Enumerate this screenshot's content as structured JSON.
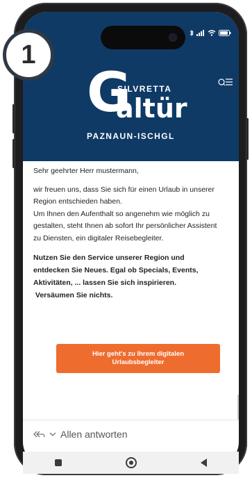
{
  "logo": {
    "top": "SILVRETTA",
    "initial": "G",
    "main": "altür",
    "bottom": "PAZNAUN-ISCHGL"
  },
  "step": {
    "number": "1"
  },
  "email": {
    "greeting": "Sehr geehrter Herr mustermann,",
    "paragraph1": "wir freuen uns, dass Sie sich für einen Urlaub in unserer Region entschieden haben.",
    "paragraph2": "Um Ihnen den Aufenthalt so angenehm wie möglich zu gestalten, steht Ihnen ab sofort Ihr persönlicher Assistent zu Diensten, ein digitaler Reisebegleiter.",
    "bold_paragraph": "Nutzen Sie den Service unserer Region und entdecken Sie Neues. Egal ob Specials, Events, Aktivitäten, ... lassen Sie sich inspirieren.",
    "bold_line2": "Versäumen Sie nichts.",
    "cta_line1": "Hier geht's zu Ihrem digitalen",
    "cta_line2": "Urlaubsbegleiter"
  },
  "reply": {
    "icon": "reply-all-icon",
    "label": "Allen antworten"
  },
  "navbar": {
    "icons": [
      "recent-apps-icon",
      "home-icon",
      "back-icon"
    ]
  },
  "status_icons": [
    "bluetooth-icon",
    "signal-icon",
    "wifi-icon",
    "battery-icon"
  ],
  "colors": {
    "header_bg": "#0f3a66",
    "cta_bg": "#ef6c2f"
  }
}
